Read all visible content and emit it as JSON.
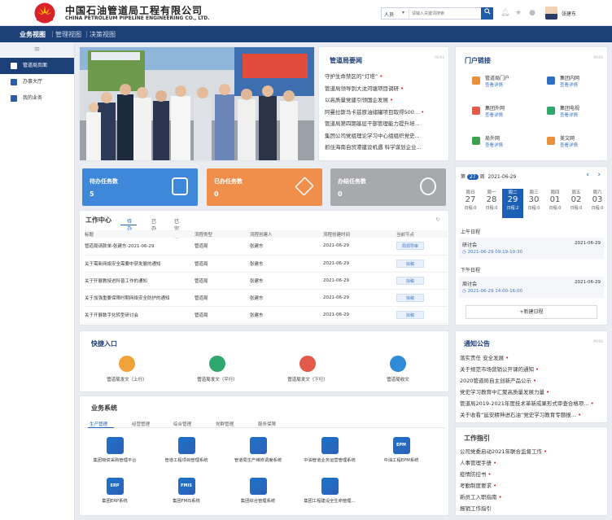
{
  "header": {
    "cn_title": "中国石油管道局工程有限公司",
    "en_title": "CHINA PETROLEUM PIPELINE ENGINEERING CO., LTD.",
    "search_scope": "人员",
    "search_placeholder": "请输入关键词搜索",
    "user": "张建东"
  },
  "nav": {
    "items": [
      "业务视图",
      "管理视图",
      "决策视图"
    ]
  },
  "sidebar": {
    "items": [
      "管道局页面",
      "办事大厅",
      "我的业务"
    ]
  },
  "news": {
    "title": "管道局要闻",
    "more": "MORE",
    "items": [
      {
        "text": "守护生命禁区的“灯塔”",
        "red": true
      },
      {
        "text": "管道局领导到大沈河塘项目调研",
        "red": true
      },
      {
        "text": "以高质量党建引领国企发展",
        "red": true
      },
      {
        "text": "阿曼拉斯马卡兹原油储罐项目取得500...",
        "red": true
      },
      {
        "text": "管道局第四期基层干部管理能力提升培...",
        "red": false
      },
      {
        "text": "集团公司党组理论学习中心组组织党史...",
        "red": false
      },
      {
        "text": "抓住海南自贸港建设机遇 科学谋划企业...",
        "red": false
      }
    ]
  },
  "portal": {
    "title": "门户链接",
    "more": "MORE",
    "items": [
      {
        "name": "管道局门户",
        "link": "查看详情",
        "color": "#e8913a"
      },
      {
        "name": "集团内网",
        "link": "查看详情",
        "color": "#2f6fc1"
      },
      {
        "name": "集团外网",
        "link": "查看详情",
        "color": "#e25b4a"
      },
      {
        "name": "集团电视",
        "link": "查看详情",
        "color": "#2fa66e"
      },
      {
        "name": "局外网",
        "link": "查看详情",
        "color": "#3fa14a"
      },
      {
        "name": "美文网",
        "link": "查看详情",
        "color": "#e8913a"
      }
    ]
  },
  "stats": [
    {
      "label": "待办任务数",
      "count": "5",
      "color": "#3f87d8"
    },
    {
      "label": "已办任务数",
      "count": "0",
      "color": "#ef8f4b"
    },
    {
      "label": "办结任务数",
      "count": "0",
      "color": "#a7a9ad"
    }
  ],
  "work": {
    "title": "工作中心",
    "tabs": [
      "待办",
      "已办",
      "已完成"
    ],
    "headers": [
      "标题",
      "流程类型",
      "流程创建人",
      "流程创建时间",
      "当前节点"
    ],
    "rows": [
      [
        "管道局请款单-张建东-2021-06-29",
        "管道局",
        "张建东",
        "2021-06-29",
        "局领导审"
      ],
      [
        "关于需新网络安全需要中获发展的通知",
        "管道局",
        "张建东",
        "2021-06-29",
        "拟稿"
      ],
      [
        "关于开展教授进科普工作的通知",
        "管道局",
        "张建东",
        "2021-06-29",
        "拟稿"
      ],
      [
        "关于加强重要保障时期网络安全防护的通知",
        "管道局",
        "张建东",
        "2021-06-29",
        "拟稿"
      ],
      [
        "关于开展数字化转型研讨会",
        "管道局",
        "张建东",
        "2021-06-29",
        "拟稿"
      ]
    ]
  },
  "calendar": {
    "week_label": "第",
    "week_num": "27",
    "week_suffix": "周",
    "date": "2021-06-29",
    "days": [
      {
        "w": "周日",
        "d": "27",
        "c": "日程:0"
      },
      {
        "w": "周一",
        "d": "28",
        "c": "日程:0"
      },
      {
        "w": "周二",
        "d": "29",
        "c": "日程:2"
      },
      {
        "w": "周三",
        "d": "30",
        "c": "日程:0"
      },
      {
        "w": "周四",
        "d": "01",
        "c": "日程:0"
      },
      {
        "w": "周五",
        "d": "02",
        "c": "日程:0"
      },
      {
        "w": "周六",
        "d": "03",
        "c": "日程:0"
      }
    ],
    "am_label": "上午日程",
    "am_item": "研讨会",
    "am_date": "2021-06-29",
    "am_time": "2021-06-29 09:19-10:30",
    "pm_label": "下午日程",
    "pm_item": "周讨会",
    "pm_date": "2021-06-29",
    "pm_time": "2021-06-29 14:00-16:00",
    "new_button": "+新建日程"
  },
  "quick": {
    "title": "快捷入口",
    "items": [
      {
        "label": "管道局发文（上行）",
        "color": "#f0a23a"
      },
      {
        "label": "管道局发文（平行）",
        "color": "#2fa66e"
      },
      {
        "label": "管道局发文（下行）",
        "color": "#e25b4a"
      },
      {
        "label": "管道局收文",
        "color": "#2f8ad8"
      }
    ]
  },
  "systems": {
    "title": "业务系统",
    "tabs": [
      "生产管理",
      "经营管理",
      "综合管理",
      "党群管理",
      "服务保障"
    ],
    "items": [
      {
        "label": "集团物资采购管理平台",
        "icon": ""
      },
      {
        "label": "管道工程项目管理系统",
        "icon": ""
      },
      {
        "label": "管道局生产维修调度系统",
        "icon": ""
      },
      {
        "label": "中油管道业务运营管理系统",
        "icon": ""
      },
      {
        "label": "中油工程EPM系统",
        "icon": "EPM"
      },
      {
        "label": "集团ERP系统",
        "icon": "ERP"
      },
      {
        "label": "集团FMIS系统",
        "icon": "FMIS"
      },
      {
        "label": "集团综合管理系统",
        "icon": ""
      },
      {
        "label": "集团工程建设全生命管理...",
        "icon": ""
      }
    ]
  },
  "notice": {
    "title": "通知公告",
    "more": "MORE",
    "items": [
      {
        "text": "落实责任 安全发展",
        "red": true
      },
      {
        "text": "关于规范市场营销公开课的通知",
        "red": true
      },
      {
        "text": "2020管道局自主创新产品公示",
        "red": true
      },
      {
        "text": "党史学习教育中汇聚高质量发展力量",
        "red": true
      },
      {
        "text": "管道局2019-2021年度技术革新成果形式审查合格项...",
        "red": true
      },
      {
        "text": "关于收看“延安精神进石油”党史学习教育专题报...",
        "red": true
      }
    ]
  },
  "guide": {
    "title": "工作指引",
    "items": [
      {
        "text": "公司党委启动2021年联合监督工作",
        "red": true
      },
      {
        "text": "人事管理手册",
        "red": true
      },
      {
        "text": "疫情防控书",
        "red": true
      },
      {
        "text": "考勤制度要求",
        "red": true
      },
      {
        "text": "新员工入职指南",
        "red": true
      },
      {
        "text": "报销工作指引",
        "red": false
      }
    ]
  }
}
